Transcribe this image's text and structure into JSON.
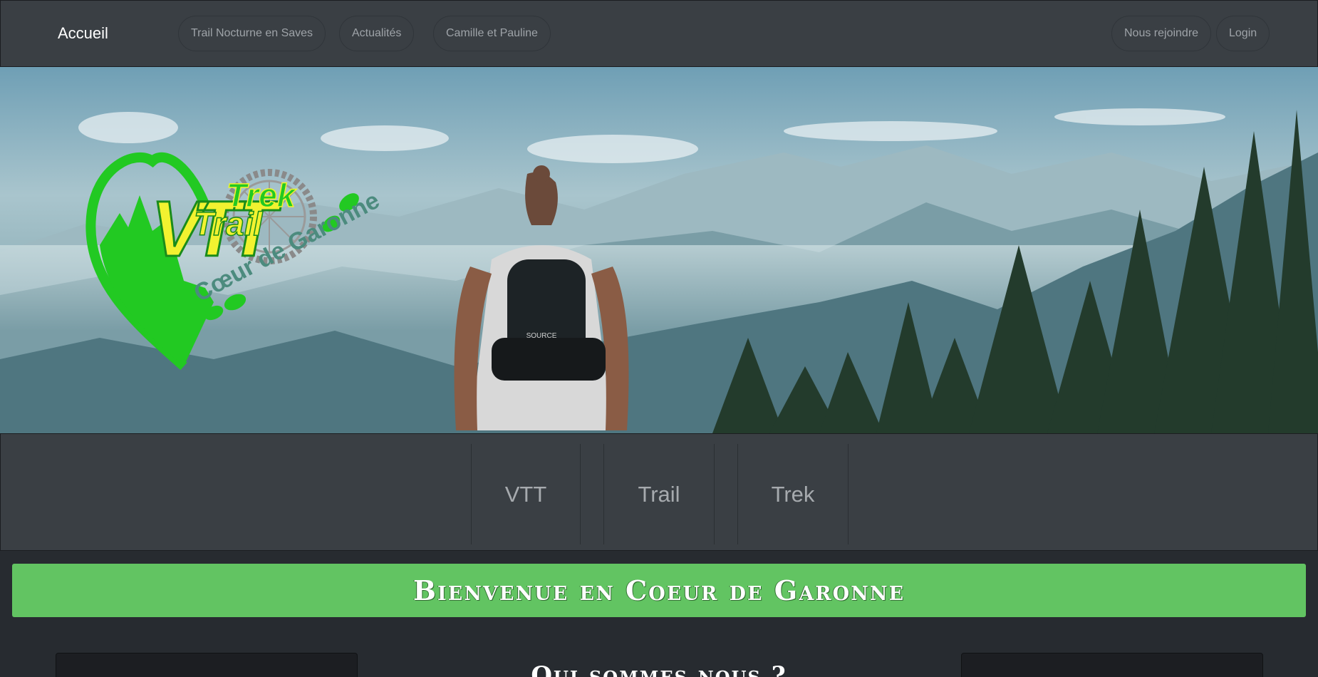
{
  "navbar": {
    "brand": "Accueil",
    "left_items": [
      {
        "label": "Trail Nocturne en Saves"
      },
      {
        "label": "Actualités"
      },
      {
        "label": "Camille et Pauline"
      }
    ],
    "right_items": [
      {
        "label": "Nous rejoindre"
      },
      {
        "label": "Login"
      }
    ]
  },
  "hero": {
    "logo": {
      "word_vtt": "VTT",
      "word_trek": "Trek",
      "word_trail": "Trail",
      "tagline": "Cœur de Garonne",
      "colors": {
        "green": "#22c922",
        "yellow": "#f2f230",
        "grey": "#8a8a8a",
        "teal": "#4c8b7e"
      }
    },
    "backpack_brand": "SOURCE"
  },
  "subnav": {
    "items": [
      {
        "label": "VTT"
      },
      {
        "label": "Trail"
      },
      {
        "label": "Trek"
      }
    ]
  },
  "welcome": {
    "title": "Bienvenue en Coeur de Garonne",
    "color": "#62c462"
  },
  "about": {
    "title": "Qui sommes nous ?"
  }
}
